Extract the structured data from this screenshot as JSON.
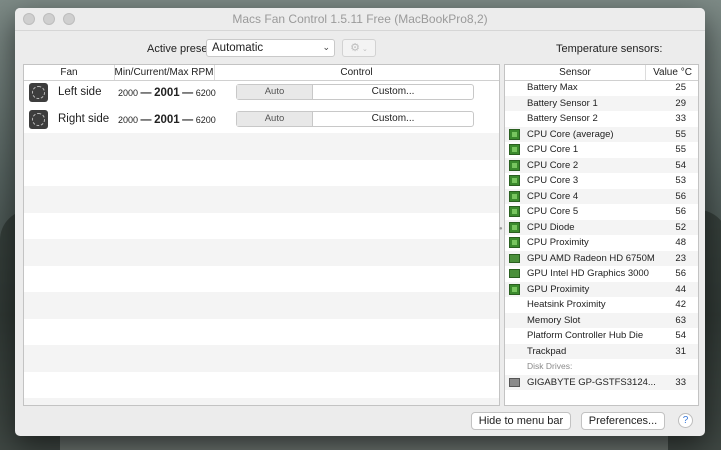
{
  "window": {
    "title": "Macs Fan Control 1.5.11 Free (MacBookPro8,2)"
  },
  "toolbar": {
    "preset_label": "Active preset:",
    "preset_value": "Automatic",
    "gear_icon": "gear-icon",
    "temperature_label": "Temperature sensors:"
  },
  "fans": {
    "columns": [
      "Fan",
      "Min/Current/Max RPM",
      "Control"
    ],
    "rows": [
      {
        "name": "Left side",
        "min": "2000",
        "current": "2001",
        "max": "6200",
        "auto_label": "Auto",
        "custom_label": "Custom..."
      },
      {
        "name": "Right side",
        "min": "2000",
        "current": "2001",
        "max": "6200",
        "auto_label": "Auto",
        "custom_label": "Custom..."
      }
    ],
    "dash": "—"
  },
  "sensors": {
    "columns": [
      "Sensor",
      "Value °C"
    ],
    "rows": [
      {
        "name": "Battery Max",
        "value": "25",
        "icon": "none"
      },
      {
        "name": "Battery Sensor 1",
        "value": "29",
        "icon": "none"
      },
      {
        "name": "Battery Sensor 2",
        "value": "33",
        "icon": "none"
      },
      {
        "name": "CPU Core (average)",
        "value": "55",
        "icon": "cpu-chip-icon"
      },
      {
        "name": "CPU Core 1",
        "value": "55",
        "icon": "cpu-chip-icon"
      },
      {
        "name": "CPU Core 2",
        "value": "54",
        "icon": "cpu-chip-icon"
      },
      {
        "name": "CPU Core 3",
        "value": "53",
        "icon": "cpu-chip-icon"
      },
      {
        "name": "CPU Core 4",
        "value": "56",
        "icon": "cpu-chip-icon"
      },
      {
        "name": "CPU Core 5",
        "value": "56",
        "icon": "cpu-chip-icon"
      },
      {
        "name": "CPU Diode",
        "value": "52",
        "icon": "cpu-chip-icon"
      },
      {
        "name": "CPU Proximity",
        "value": "48",
        "icon": "cpu-chip-icon"
      },
      {
        "name": "GPU AMD Radeon HD 6750M",
        "value": "23",
        "icon": "gpu-card-icon"
      },
      {
        "name": "GPU Intel HD Graphics 3000",
        "value": "56",
        "icon": "gpu-card-icon"
      },
      {
        "name": "GPU Proximity",
        "value": "44",
        "icon": "cpu-chip-icon"
      },
      {
        "name": "Heatsink Proximity",
        "value": "42",
        "icon": "none"
      },
      {
        "name": "Memory Slot",
        "value": "63",
        "icon": "none"
      },
      {
        "name": "Platform Controller Hub Die",
        "value": "54",
        "icon": "none"
      },
      {
        "name": "Trackpad",
        "value": "31",
        "icon": "none"
      }
    ],
    "disk_header": "Disk Drives:",
    "disk": {
      "name": "GIGABYTE GP-GSTFS3124...",
      "value": "33",
      "icon": "disk-drive-icon"
    }
  },
  "footer": {
    "hide_label": "Hide to menu bar",
    "prefs_label": "Preferences...",
    "help_label": "?"
  }
}
